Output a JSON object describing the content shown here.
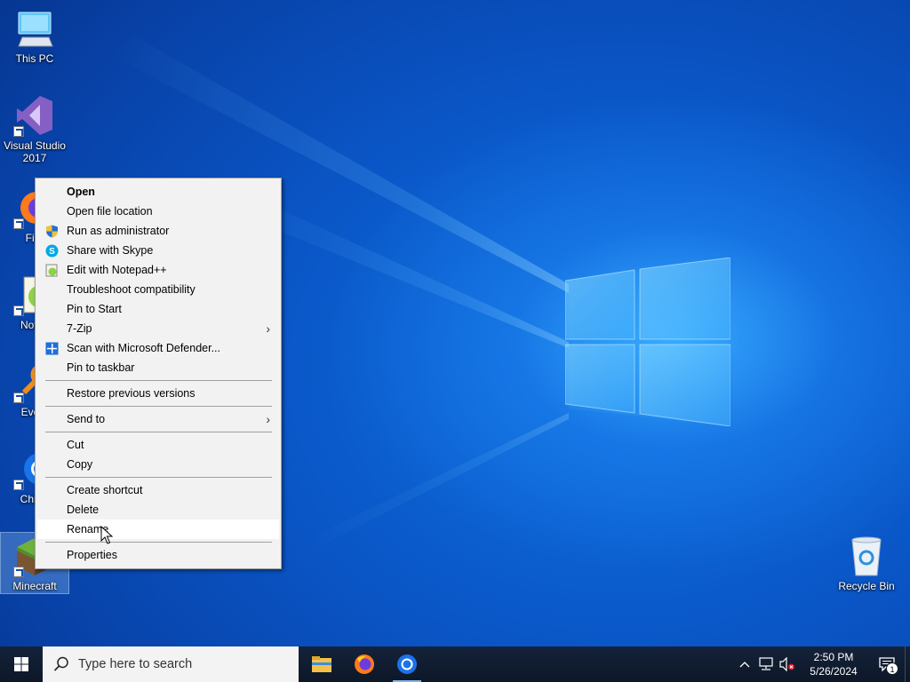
{
  "desktop": {
    "icons": [
      {
        "label": "This PC",
        "icon": "computer-icon"
      },
      {
        "label": "Visual Studio 2017",
        "icon": "visual-studio-icon"
      },
      {
        "label": "Fire",
        "icon": "firefox-icon"
      },
      {
        "label": "Notep",
        "icon": "notepad-plus-plus-icon"
      },
      {
        "label": "Every",
        "icon": "everything-search-icon"
      },
      {
        "label": "Chron",
        "icon": "chrome-icon"
      },
      {
        "label": "Minecraft",
        "icon": "minecraft-icon"
      },
      {
        "label": "Recycle Bin",
        "icon": "recycle-bin-icon"
      }
    ]
  },
  "context_menu": {
    "items": [
      {
        "label": "Open",
        "bold": true
      },
      {
        "label": "Open file location"
      },
      {
        "label": "Run as administrator",
        "icon": "uac-shield-icon"
      },
      {
        "label": "Share with Skype",
        "icon": "skype-icon"
      },
      {
        "label": "Edit with Notepad++",
        "icon": "notepad-plus-plus-icon"
      },
      {
        "label": "Troubleshoot compatibility"
      },
      {
        "label": "Pin to Start"
      },
      {
        "label": "7-Zip",
        "submenu": true
      },
      {
        "label": "Scan with Microsoft Defender...",
        "icon": "defender-icon"
      },
      {
        "label": "Pin to taskbar"
      },
      {
        "label": "Restore previous versions"
      },
      {
        "label": "Send to",
        "submenu": true
      },
      {
        "label": "Cut"
      },
      {
        "label": "Copy"
      },
      {
        "label": "Create shortcut"
      },
      {
        "label": "Delete"
      },
      {
        "label": "Rename",
        "hovered": true
      },
      {
        "label": "Properties"
      }
    ],
    "submenu_arrow": "›"
  },
  "taskbar": {
    "search_placeholder": "Type here to search",
    "pinned": [
      "file-explorer-icon",
      "firefox-icon",
      "chrome-icon"
    ],
    "clock_time": "2:50 PM",
    "clock_date": "5/26/2024",
    "notification_count": "1"
  },
  "colors": {
    "taskbar_bg": "#0d1727",
    "menu_bg": "#f2f2f2",
    "menu_hover": "#ffffff",
    "desktop_accent": "#0a56c7"
  }
}
